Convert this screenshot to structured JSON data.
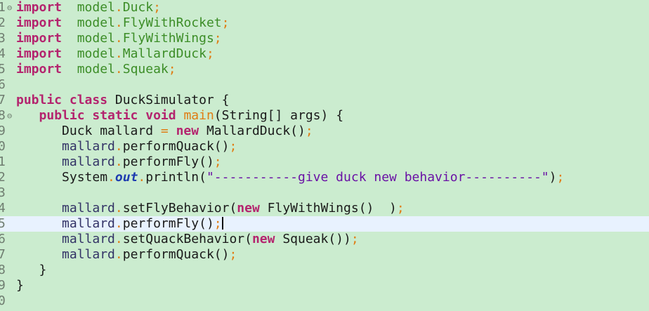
{
  "editor": {
    "line_numbers": [
      "1",
      "2",
      "3",
      "4",
      "5",
      "6",
      "7",
      "8",
      "9",
      "0",
      "1",
      "2",
      "3",
      "4",
      "5",
      "6",
      "7",
      "8",
      "9",
      "0"
    ],
    "fold_marker": "⊖",
    "lines": [
      [
        [
          "k",
          "import"
        ],
        [
          "",
          "  "
        ],
        [
          "id",
          "model"
        ],
        [
          "p",
          "."
        ],
        [
          "id",
          "Duck"
        ],
        [
          "p",
          ";"
        ]
      ],
      [
        [
          "k",
          "import"
        ],
        [
          "",
          "  "
        ],
        [
          "id",
          "model"
        ],
        [
          "p",
          "."
        ],
        [
          "id",
          "FlyWithRocket"
        ],
        [
          "p",
          ";"
        ]
      ],
      [
        [
          "k",
          "import"
        ],
        [
          "",
          "  "
        ],
        [
          "id",
          "model"
        ],
        [
          "p",
          "."
        ],
        [
          "id",
          "FlyWithWings"
        ],
        [
          "p",
          ";"
        ]
      ],
      [
        [
          "k",
          "import"
        ],
        [
          "",
          "  "
        ],
        [
          "id",
          "model"
        ],
        [
          "p",
          "."
        ],
        [
          "id",
          "MallardDuck"
        ],
        [
          "p",
          ";"
        ]
      ],
      [
        [
          "k",
          "import"
        ],
        [
          "",
          "  "
        ],
        [
          "id",
          "model"
        ],
        [
          "p",
          "."
        ],
        [
          "id",
          "Squeak"
        ],
        [
          "p",
          ";"
        ]
      ],
      [],
      [
        [
          "k",
          "public class"
        ],
        [
          "",
          " DuckSimulator {"
        ]
      ],
      [
        [
          "",
          "   "
        ],
        [
          "k",
          "public static void"
        ],
        [
          "",
          " "
        ],
        [
          "mf",
          "main"
        ],
        [
          "",
          "(String[] args) {"
        ]
      ],
      [
        [
          "",
          "      Duck mallard "
        ],
        [
          "p",
          "="
        ],
        [
          "",
          " "
        ],
        [
          "k",
          "new"
        ],
        [
          "",
          " MallardDuck()"
        ],
        [
          "p",
          ";"
        ]
      ],
      [
        [
          "",
          "      "
        ],
        [
          "v",
          "mallard"
        ],
        [
          "p",
          "."
        ],
        [
          "",
          "performQuack()"
        ],
        [
          "p",
          ";"
        ]
      ],
      [
        [
          "",
          "      "
        ],
        [
          "v",
          "mallard"
        ],
        [
          "p",
          "."
        ],
        [
          "",
          "performFly()"
        ],
        [
          "p",
          ";"
        ]
      ],
      [
        [
          "",
          "      System"
        ],
        [
          "p",
          "."
        ],
        [
          "t",
          "out"
        ],
        [
          "p",
          "."
        ],
        [
          "",
          "println("
        ],
        [
          "s",
          "\"-----------give duck new behavior----------\""
        ],
        [
          "",
          ")"
        ],
        [
          "p",
          ";"
        ]
      ],
      [],
      [
        [
          "",
          "      "
        ],
        [
          "v",
          "mallard"
        ],
        [
          "p",
          "."
        ],
        [
          "",
          "setFlyBehavior("
        ],
        [
          "k",
          "new"
        ],
        [
          "",
          " FlyWithWings()  )"
        ],
        [
          "p",
          ";"
        ]
      ],
      [
        [
          "",
          "      "
        ],
        [
          "v",
          "mallard"
        ],
        [
          "p",
          "."
        ],
        [
          "",
          "performFly()"
        ],
        [
          "p",
          ";"
        ],
        [
          "caret",
          ""
        ]
      ],
      [
        [
          "",
          "      "
        ],
        [
          "v",
          "mallard"
        ],
        [
          "p",
          "."
        ],
        [
          "",
          "setQuackBehavior("
        ],
        [
          "k",
          "new"
        ],
        [
          "",
          " Squeak())"
        ],
        [
          "p",
          ";"
        ]
      ],
      [
        [
          "",
          "      "
        ],
        [
          "v",
          "mallard"
        ],
        [
          "p",
          "."
        ],
        [
          "",
          "performQuack()"
        ],
        [
          "p",
          ";"
        ]
      ],
      [
        [
          "",
          "   }"
        ]
      ],
      [
        [
          "",
          "}"
        ]
      ],
      []
    ]
  }
}
